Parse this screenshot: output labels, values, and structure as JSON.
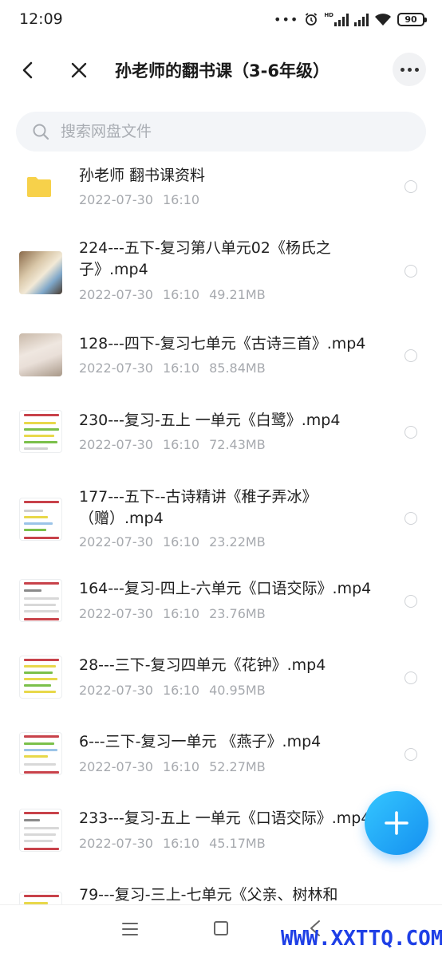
{
  "status_bar": {
    "time": "12:09",
    "battery": "90",
    "dots": "•••",
    "hd": "HD"
  },
  "header": {
    "title": "孙老师的翻书课（3-6年级）"
  },
  "search": {
    "placeholder": "搜索网盘文件",
    "value": ""
  },
  "files": [
    {
      "name": "孙老师 翻书课资料",
      "date": "2022-07-30",
      "time": "16:10",
      "size": "",
      "thumbnail": "folder-icon"
    },
    {
      "name": "224---五下-复习第八单元02《杨氏之子》.mp4",
      "date": "2022-07-30",
      "time": "16:10",
      "size": "49.21MB",
      "thumbnail": "video-thumbnail"
    },
    {
      "name": "128---四下-复习七单元《古诗三首》.mp4",
      "date": "2022-07-30",
      "time": "16:10",
      "size": "85.84MB",
      "thumbnail": "video-thumbnail"
    },
    {
      "name": "230---复习-五上 一单元《白鹭》.mp4",
      "date": "2022-07-30",
      "time": "16:10",
      "size": "72.43MB",
      "thumbnail": "video-thumbnail"
    },
    {
      "name": "177---五下--古诗精讲《稚子弄冰》（赠）.mp4",
      "date": "2022-07-30",
      "time": "16:10",
      "size": "23.22MB",
      "thumbnail": "video-thumbnail"
    },
    {
      "name": "164---复习-四上-六单元《口语交际》.mp4",
      "date": "2022-07-30",
      "time": "16:10",
      "size": "23.76MB",
      "thumbnail": "video-thumbnail"
    },
    {
      "name": "28---三下-复习四单元《花钟》.mp4",
      "date": "2022-07-30",
      "time": "16:10",
      "size": "40.95MB",
      "thumbnail": "video-thumbnail"
    },
    {
      "name": "6---三下-复习一单元 《燕子》.mp4",
      "date": "2022-07-30",
      "time": "16:10",
      "size": "52.27MB",
      "thumbnail": "video-thumbnail"
    },
    {
      "name": "233---复习-五上 一单元《口语交际》.mp4",
      "date": "2022-07-30",
      "time": "16:10",
      "size": "45.17MB",
      "thumbnail": "video-thumbnail"
    },
    {
      "name": "79---复习-三上-七单元《父亲、树林和",
      "date": "",
      "time": "",
      "size": "",
      "thumbnail": "video-thumbnail"
    }
  ],
  "fab": {
    "label": "+"
  },
  "watermark": "WWW.XXTTQ.COM",
  "colors": {
    "accent": "#1e90f0",
    "meta_text": "#a6a9ae",
    "folder": "#f7d14a",
    "watermark": "#1e3fe6"
  }
}
